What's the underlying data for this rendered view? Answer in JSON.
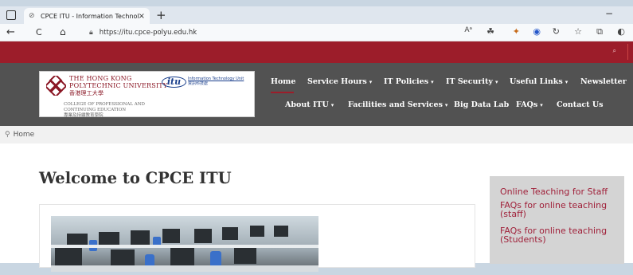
{
  "browser": {
    "tab_title": "CPCE ITU - Information Technolo",
    "tab_close": "×",
    "new_tab": "+",
    "url": "https://itu.cpce-polyu.edu.hk",
    "minimize": "−",
    "maximize": "☐",
    "back": "←",
    "refresh": "C",
    "home": "⌂",
    "read_aloud": "Aᵃ"
  },
  "logo": {
    "university_en_1": "The Hong Kong",
    "university_en_2": "Polytechnic University",
    "university_zh": "香港理工大學",
    "itu_mark": "itu",
    "itu_en": "Information Technology Unit",
    "itu_zh": "資訊科技處",
    "college_en_1": "College of Professional and",
    "college_en_2": "Continuing Education",
    "college_zh": "專業及持續教育學院"
  },
  "nav": {
    "row1": [
      {
        "label": "Home",
        "dropdown": false
      },
      {
        "label": "Service Hours",
        "dropdown": true
      },
      {
        "label": "IT Policies",
        "dropdown": true
      },
      {
        "label": "IT Security",
        "dropdown": true
      },
      {
        "label": "Useful Links",
        "dropdown": true
      },
      {
        "label": "Newsletter",
        "dropdown": false
      }
    ],
    "row2": [
      {
        "label": "About ITU",
        "dropdown": true
      },
      {
        "label": "Facilities and Services",
        "dropdown": true
      },
      {
        "label": "Big Data Lab",
        "dropdown": false
      },
      {
        "label": "FAQs",
        "dropdown": true
      },
      {
        "label": "Contact Us",
        "dropdown": false
      }
    ],
    "caret": "▾"
  },
  "breadcrumb": {
    "home": "Home"
  },
  "main": {
    "title": "Welcome to CPCE ITU"
  },
  "sidebar": {
    "links": [
      {
        "label": "Online Teaching for Staff"
      },
      {
        "label": "FAQs for online teaching (staff)"
      },
      {
        "label": "FAQs for online teaching (Students)"
      }
    ]
  },
  "colors": {
    "brand_red": "#9c1d2a",
    "nav_grey": "#525252",
    "link": "#a0213a"
  }
}
